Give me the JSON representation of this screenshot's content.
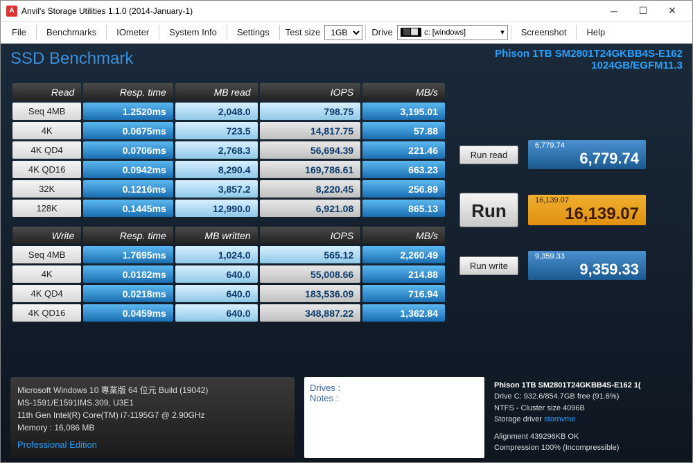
{
  "window": {
    "title": "Anvil's Storage Utilities 1.1.0 (2014-January-1)"
  },
  "menu": {
    "file": "File",
    "benchmarks": "Benchmarks",
    "iometer": "IOmeter",
    "system_info": "System Info",
    "settings": "Settings",
    "test_size": "Test size",
    "test_size_val": "1GB",
    "drive": "Drive",
    "drive_val": "c: [windows]",
    "screenshot": "Screenshot",
    "help": "Help"
  },
  "header": {
    "title": "SSD Benchmark",
    "device": "Phison 1TB SM2801T24GKBB4S-E162",
    "device2": "1024GB/EGFM11.3"
  },
  "cols": {
    "read": "Read",
    "write": "Write",
    "resp": "Resp. time",
    "mbread": "MB read",
    "mbwritten": "MB written",
    "iops": "IOPS",
    "mbs": "MB/s"
  },
  "read_rows": [
    {
      "label": "Seq 4MB",
      "resp": "1.2520ms",
      "mb": "2,048.0",
      "iops": "798.75",
      "mbs": "3,195.01"
    },
    {
      "label": "4K",
      "resp": "0.0675ms",
      "mb": "723.5",
      "iops": "14,817.75",
      "mbs": "57.88"
    },
    {
      "label": "4K QD4",
      "resp": "0.0706ms",
      "mb": "2,768.3",
      "iops": "56,694.39",
      "mbs": "221.46"
    },
    {
      "label": "4K QD16",
      "resp": "0.0942ms",
      "mb": "8,290.4",
      "iops": "169,786.61",
      "mbs": "663.23"
    },
    {
      "label": "32K",
      "resp": "0.1216ms",
      "mb": "3,857.2",
      "iops": "8,220.45",
      "mbs": "256.89"
    },
    {
      "label": "128K",
      "resp": "0.1445ms",
      "mb": "12,990.0",
      "iops": "6,921.08",
      "mbs": "865.13"
    }
  ],
  "write_rows": [
    {
      "label": "Seq 4MB",
      "resp": "1.7695ms",
      "mb": "1,024.0",
      "iops": "565.12",
      "mbs": "2,260.49"
    },
    {
      "label": "4K",
      "resp": "0.0182ms",
      "mb": "640.0",
      "iops": "55,008.66",
      "mbs": "214.88"
    },
    {
      "label": "4K QD4",
      "resp": "0.0218ms",
      "mb": "640.0",
      "iops": "183,536.09",
      "mbs": "716.94"
    },
    {
      "label": "4K QD16",
      "resp": "0.0459ms",
      "mb": "640.0",
      "iops": "348,887.22",
      "mbs": "1,362.84"
    }
  ],
  "buttons": {
    "run_read": "Run read",
    "run": "Run",
    "run_write": "Run write"
  },
  "scores": {
    "read_small": "6,779.74",
    "read_big": "6,779.74",
    "total_small": "16,139.07",
    "total_big": "16,139.07",
    "write_small": "9,359.33",
    "write_big": "9,359.33"
  },
  "footer": {
    "os": "Microsoft Windows 10 專業版 64 位元 Build (19042)",
    "mb": "MS-1591/E1591IMS.309, U3E1",
    "cpu": "11th Gen Intel(R) Core(TM) i7-1195G7 @ 2.90GHz",
    "mem": "Memory : 16,086 MB",
    "pro": "Professional Edition",
    "drives": "Drives :",
    "notes": "Notes :",
    "r1": "Phison 1TB SM2801T24GKBB4S-E162 1(",
    "r2": "Drive C: 932.6/854.7GB free (91.6%)",
    "r3": "NTFS - Cluster size 4096B",
    "r4": "Storage driver  stornvme",
    "r5": "Alignment 439296KB OK",
    "r6": "Compression 100% (Incompressible)"
  }
}
